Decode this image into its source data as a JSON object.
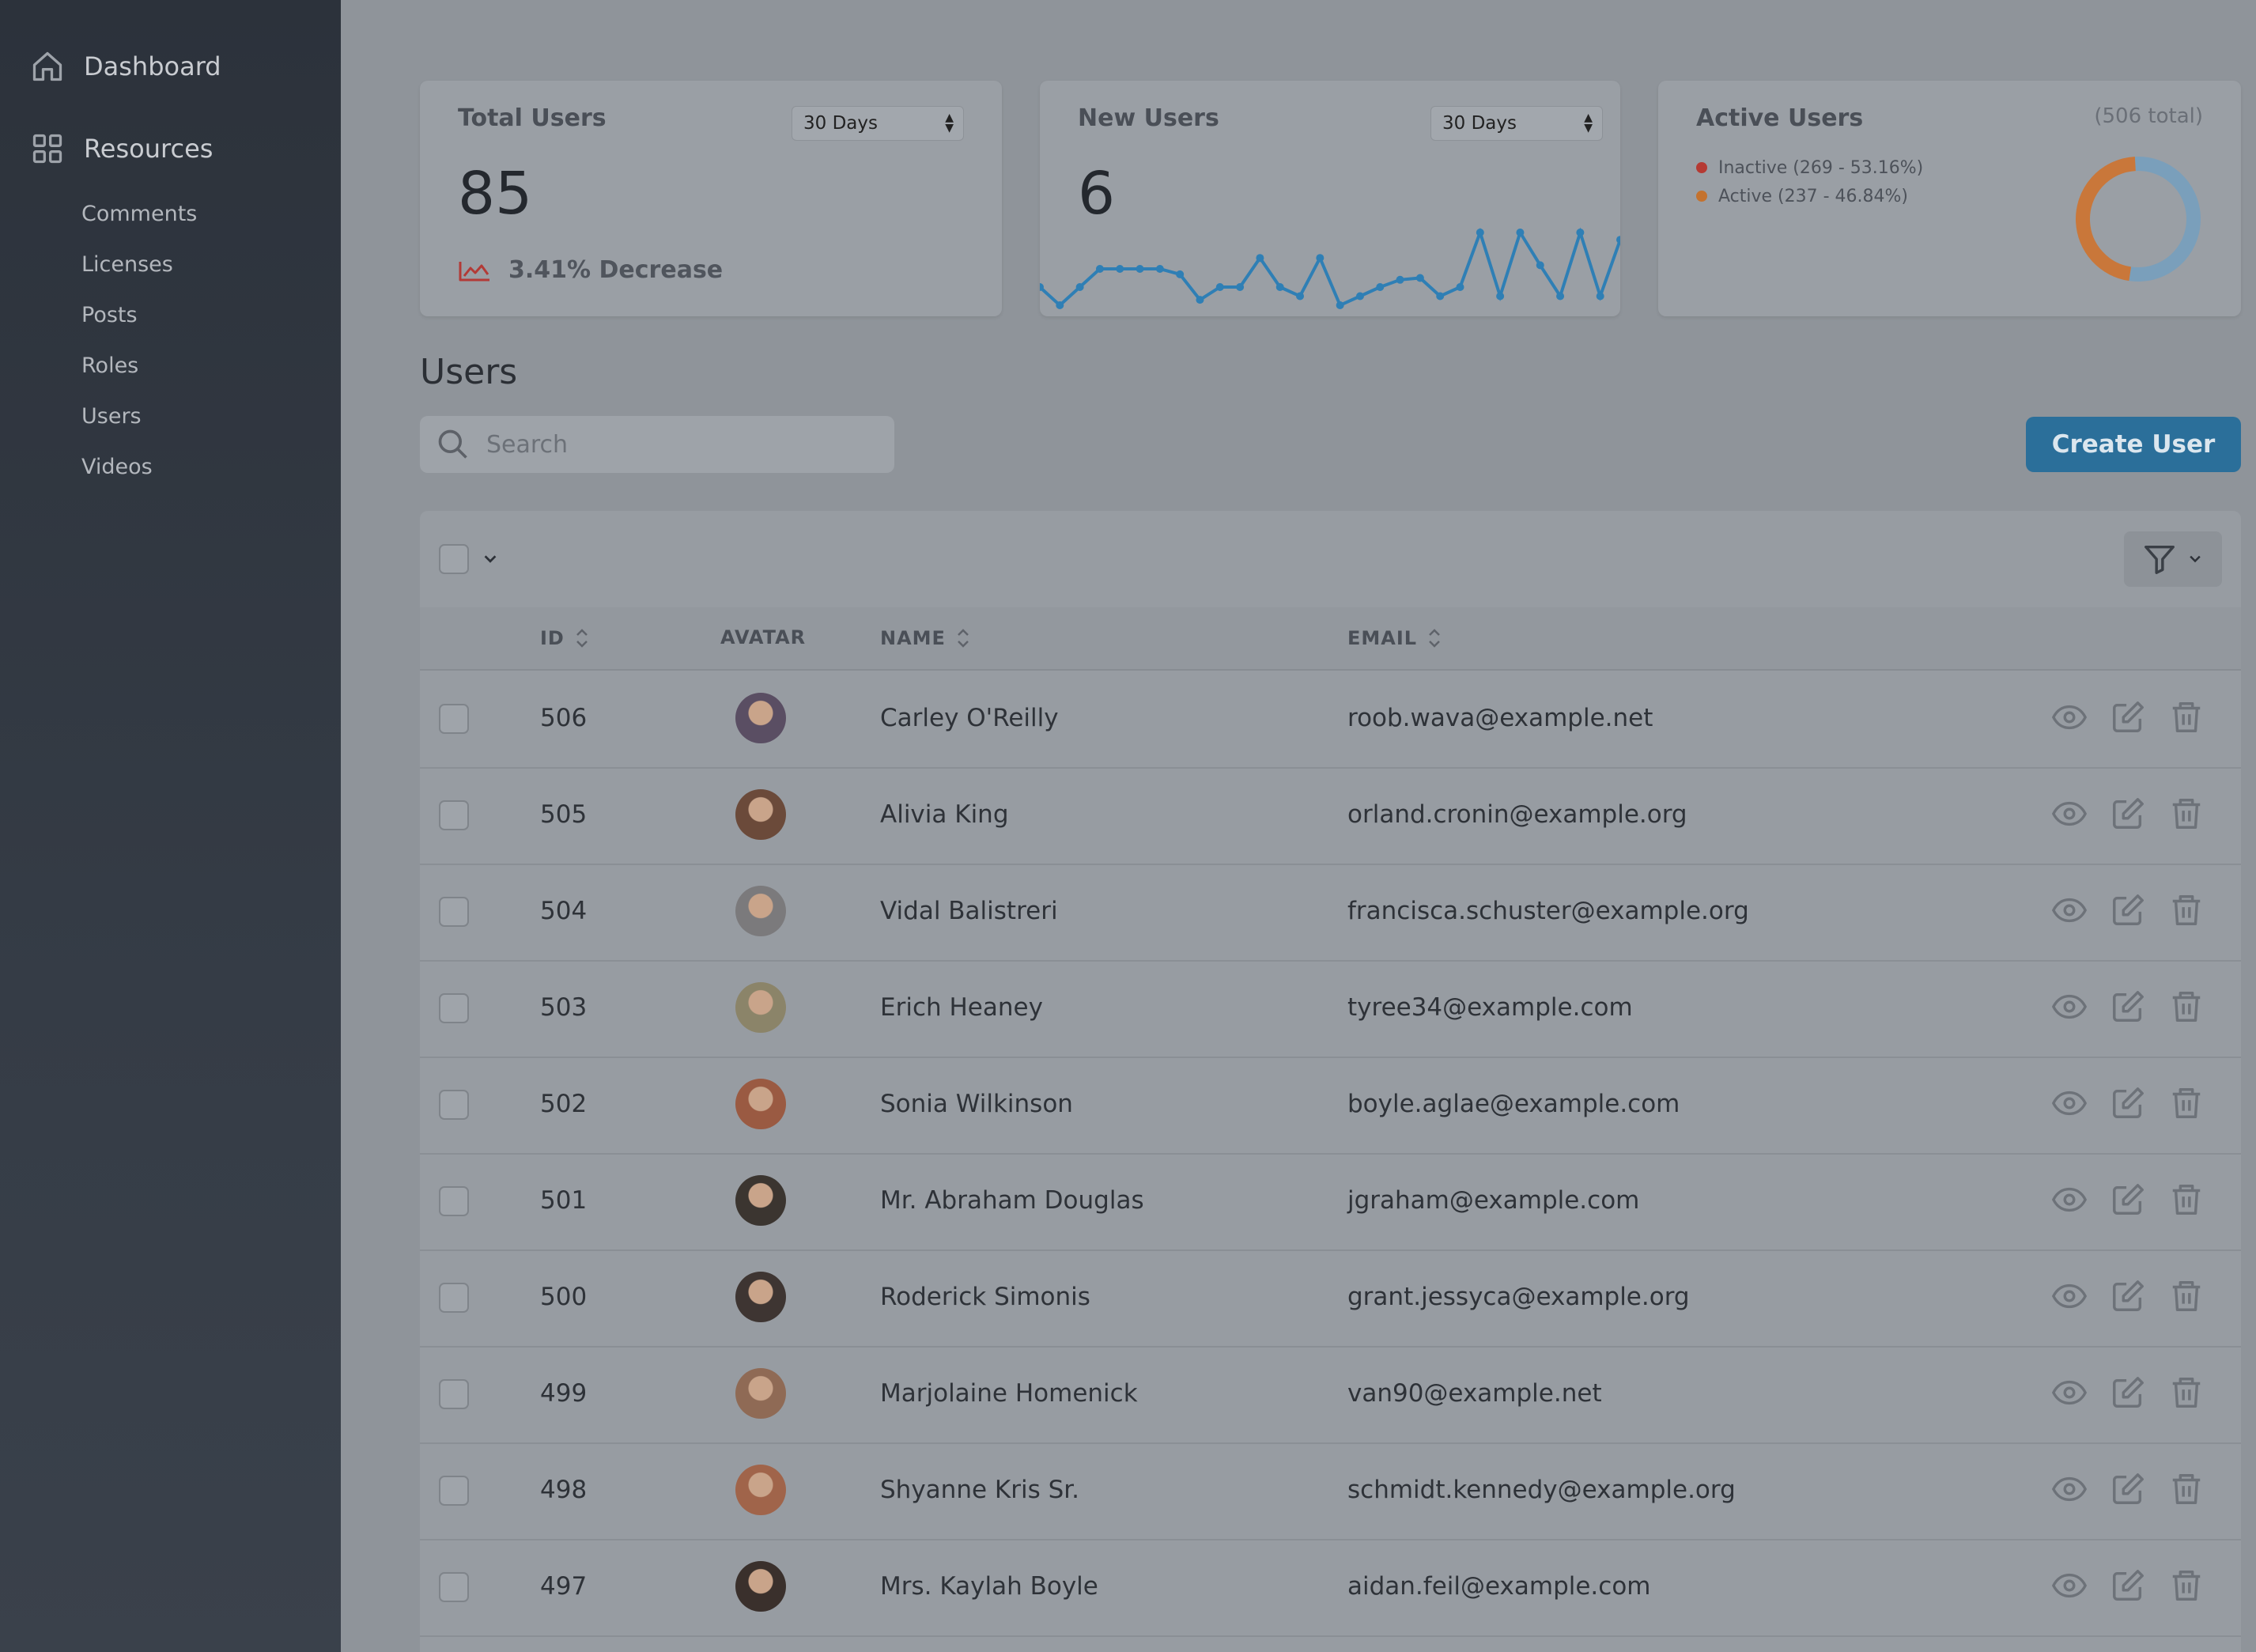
{
  "sidebar": {
    "dashboard": "Dashboard",
    "resources": "Resources",
    "items": [
      "Comments",
      "Licenses",
      "Posts",
      "Roles",
      "Users",
      "Videos"
    ]
  },
  "cards": {
    "total_users": {
      "title": "Total Users",
      "range": "30 Days",
      "value": "85",
      "trend": "3.41% Decrease"
    },
    "new_users": {
      "title": "New Users",
      "range": "30 Days",
      "value": "6"
    },
    "active_users": {
      "title": "Active Users",
      "total": "(506 total)",
      "legend": [
        "Inactive (269 - 53.16%)",
        "Active (237 - 46.84%)"
      ]
    }
  },
  "chart_data": [
    {
      "type": "line",
      "values": [
        1,
        0,
        1,
        2,
        2,
        2,
        2,
        1.7,
        0.3,
        1,
        1,
        2.6,
        1,
        0.5,
        2.6,
        0,
        0.5,
        1,
        1.4,
        1.5,
        0.5,
        1,
        4,
        0.5,
        4,
        2.2,
        0.5,
        4,
        0.5,
        3.6
      ],
      "series": [
        {
          "values": [
            1,
            0,
            1,
            2,
            2,
            2,
            2,
            1.7,
            0.3,
            1,
            1,
            2.6,
            1,
            0.5,
            2.6,
            0,
            0.5,
            1,
            1.4,
            1.5,
            0.5,
            1,
            4,
            0.5,
            4,
            2.2,
            0.5,
            4,
            0.5,
            3.6
          ]
        }
      ]
    },
    {
      "type": "pie",
      "categories": [
        "Inactive (269 - 53.16%)",
        "Active (237 - 46.84%)"
      ],
      "values": [
        269,
        237
      ]
    }
  ],
  "colors": {
    "line": "#2f7fb5",
    "inactive": "#c0392b",
    "active": "#d07a2a",
    "ring_inactive": "#7a9fbb",
    "ring_active": "#c9773a"
  },
  "users": {
    "title": "Users",
    "search_placeholder": "Search",
    "create_label": "Create User",
    "columns": {
      "id": "ID",
      "avatar": "AVATAR",
      "name": "NAME",
      "email": "EMAIL"
    },
    "rows": [
      {
        "id": "506",
        "name": "Carley O'Reilly",
        "email": "roob.wava@example.net",
        "avatar_color": "#5a4e63"
      },
      {
        "id": "505",
        "name": "Alivia King",
        "email": "orland.cronin@example.org",
        "avatar_color": "#6b4a3a"
      },
      {
        "id": "504",
        "name": "Vidal Balistreri",
        "email": "francisca.schuster@example.org",
        "avatar_color": "#7b7a7c"
      },
      {
        "id": "503",
        "name": "Erich Heaney",
        "email": "tyree34@example.com",
        "avatar_color": "#8b8469"
      },
      {
        "id": "502",
        "name": "Sonia Wilkinson",
        "email": "boyle.aglae@example.com",
        "avatar_color": "#9a5a42"
      },
      {
        "id": "501",
        "name": "Mr. Abraham Douglas",
        "email": "jgraham@example.com",
        "avatar_color": "#3b3530"
      },
      {
        "id": "500",
        "name": "Roderick Simonis",
        "email": "grant.jessyca@example.org",
        "avatar_color": "#3e3532"
      },
      {
        "id": "499",
        "name": "Marjolaine Homenick",
        "email": "van90@example.net",
        "avatar_color": "#8f6a55"
      },
      {
        "id": "498",
        "name": "Shyanne Kris Sr.",
        "email": "schmidt.kennedy@example.org",
        "avatar_color": "#a0644a"
      },
      {
        "id": "497",
        "name": "Mrs. Kaylah Boyle",
        "email": "aidan.feil@example.com",
        "avatar_color": "#3a302c"
      }
    ]
  }
}
